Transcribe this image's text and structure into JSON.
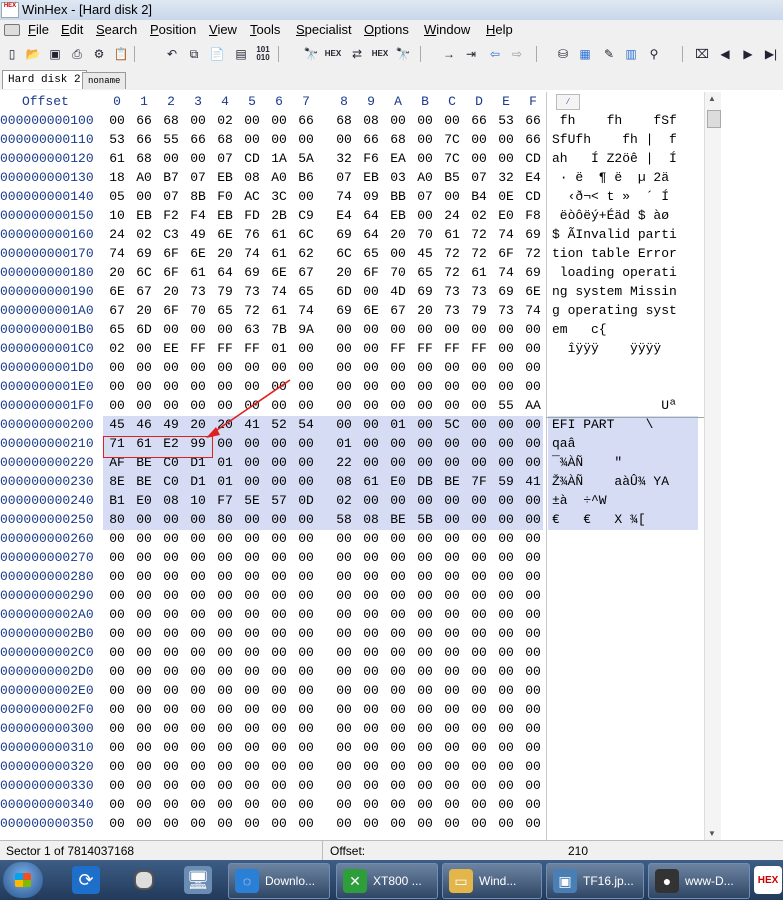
{
  "window": {
    "title": "WinHex - [Hard disk 2]",
    "app_icon_text": "HEX"
  },
  "menu": [
    "File",
    "Edit",
    "Search",
    "Position",
    "View",
    "Tools",
    "Specialist",
    "Options",
    "Window",
    "Help"
  ],
  "toolbar_icons": [
    "new-file-icon",
    "open-folder-icon",
    "save-icon",
    "print-icon",
    "properties-icon",
    "clipboard-icon",
    "undo-icon",
    "copy-icon",
    "paste-icon",
    "paste-special-icon",
    "binary-icon",
    "find-icon",
    "find-hex-icon",
    "replace-icon",
    "replace-hex-icon",
    "find-next-icon",
    "goto-offset-icon",
    "goto-sector-icon",
    "back-icon",
    "forward-icon",
    "disk-editor-icon",
    "ram-editor-icon",
    "tools-icon",
    "calculator-icon",
    "search-magnify-icon",
    "close-icon",
    "prev-icon",
    "next-icon",
    "last-icon"
  ],
  "toolbar_small_labels": {
    "binary": "101\n010",
    "hex": "HEX"
  },
  "tabs": [
    {
      "label": "Hard disk 2",
      "active": true
    },
    {
      "label": "noname",
      "active": false
    }
  ],
  "header": {
    "offset_label": "Offset",
    "columns": [
      "0",
      "1",
      "2",
      "3",
      "4",
      "5",
      "6",
      "7",
      "8",
      "9",
      "A",
      "B",
      "C",
      "D",
      "E",
      "F"
    ]
  },
  "rows": [
    {
      "offset": "000000000100",
      "bytes": [
        "00",
        "66",
        "68",
        "00",
        "02",
        "00",
        "00",
        "66",
        "68",
        "08",
        "00",
        "00",
        "00",
        "66",
        "53",
        "66"
      ],
      "text": " fh    fh    fSf"
    },
    {
      "offset": "000000000110",
      "bytes": [
        "53",
        "66",
        "55",
        "66",
        "68",
        "00",
        "00",
        "00",
        "00",
        "66",
        "68",
        "00",
        "7C",
        "00",
        "00",
        "66"
      ],
      "text": "SfUfh    fh |  f"
    },
    {
      "offset": "000000000120",
      "bytes": [
        "61",
        "68",
        "00",
        "00",
        "07",
        "CD",
        "1A",
        "5A",
        "32",
        "F6",
        "EA",
        "00",
        "7C",
        "00",
        "00",
        "CD"
      ],
      "text": "ah   Í Z2öê |  Í"
    },
    {
      "offset": "000000000130",
      "bytes": [
        "18",
        "A0",
        "B7",
        "07",
        "EB",
        "08",
        "A0",
        "B6",
        "07",
        "EB",
        "03",
        "A0",
        "B5",
        "07",
        "32",
        "E4"
      ],
      "text": " · ë  ¶ ë  µ 2ä"
    },
    {
      "offset": "000000000140",
      "bytes": [
        "05",
        "00",
        "07",
        "8B",
        "F0",
        "AC",
        "3C",
        "00",
        "74",
        "09",
        "BB",
        "07",
        "00",
        "B4",
        "0E",
        "CD"
      ],
      "text": "  ‹ð¬< t »  ´ Í"
    },
    {
      "offset": "000000000150",
      "bytes": [
        "10",
        "EB",
        "F2",
        "F4",
        "EB",
        "FD",
        "2B",
        "C9",
        "E4",
        "64",
        "EB",
        "00",
        "24",
        "02",
        "E0",
        "F8"
      ],
      "text": " ëòôëý+Éäd $ àø"
    },
    {
      "offset": "000000000160",
      "bytes": [
        "24",
        "02",
        "C3",
        "49",
        "6E",
        "76",
        "61",
        "6C",
        "69",
        "64",
        "20",
        "70",
        "61",
        "72",
        "74",
        "69"
      ],
      "text": "$ ÃInvalid parti"
    },
    {
      "offset": "000000000170",
      "bytes": [
        "74",
        "69",
        "6F",
        "6E",
        "20",
        "74",
        "61",
        "62",
        "6C",
        "65",
        "00",
        "45",
        "72",
        "72",
        "6F",
        "72"
      ],
      "text": "tion table Error"
    },
    {
      "offset": "000000000180",
      "bytes": [
        "20",
        "6C",
        "6F",
        "61",
        "64",
        "69",
        "6E",
        "67",
        "20",
        "6F",
        "70",
        "65",
        "72",
        "61",
        "74",
        "69"
      ],
      "text": " loading operati"
    },
    {
      "offset": "000000000190",
      "bytes": [
        "6E",
        "67",
        "20",
        "73",
        "79",
        "73",
        "74",
        "65",
        "6D",
        "00",
        "4D",
        "69",
        "73",
        "73",
        "69",
        "6E"
      ],
      "text": "ng system Missin"
    },
    {
      "offset": "0000000001A0",
      "bytes": [
        "67",
        "20",
        "6F",
        "70",
        "65",
        "72",
        "61",
        "74",
        "69",
        "6E",
        "67",
        "20",
        "73",
        "79",
        "73",
        "74"
      ],
      "text": "g operating syst"
    },
    {
      "offset": "0000000001B0",
      "bytes": [
        "65",
        "6D",
        "00",
        "00",
        "00",
        "63",
        "7B",
        "9A",
        "00",
        "00",
        "00",
        "00",
        "00",
        "00",
        "00",
        "00"
      ],
      "text": "em   c{"
    },
    {
      "offset": "0000000001C0",
      "bytes": [
        "02",
        "00",
        "EE",
        "FF",
        "FF",
        "FF",
        "01",
        "00",
        "00",
        "00",
        "FF",
        "FF",
        "FF",
        "FF",
        "00",
        "00"
      ],
      "text": "  îÿÿÿ    ÿÿÿÿ"
    },
    {
      "offset": "0000000001D0",
      "bytes": [
        "00",
        "00",
        "00",
        "00",
        "00",
        "00",
        "00",
        "00",
        "00",
        "00",
        "00",
        "00",
        "00",
        "00",
        "00",
        "00"
      ],
      "text": ""
    },
    {
      "offset": "0000000001E0",
      "bytes": [
        "00",
        "00",
        "00",
        "00",
        "00",
        "00",
        "00",
        "00",
        "00",
        "00",
        "00",
        "00",
        "00",
        "00",
        "00",
        "00"
      ],
      "text": ""
    },
    {
      "offset": "0000000001F0",
      "bytes": [
        "00",
        "00",
        "00",
        "00",
        "00",
        "00",
        "00",
        "00",
        "00",
        "00",
        "00",
        "00",
        "00",
        "00",
        "55",
        "AA"
      ],
      "text": "              Uª"
    },
    {
      "offset": "000000000200",
      "bytes": [
        "45",
        "46",
        "49",
        "20",
        "20",
        "41",
        "52",
        "54",
        "00",
        "00",
        "01",
        "00",
        "5C",
        "00",
        "00",
        "00"
      ],
      "text": "EFI PART    \\"
    },
    {
      "offset": "000000000210",
      "bytes": [
        "71",
        "61",
        "E2",
        "99",
        "00",
        "00",
        "00",
        "00",
        "01",
        "00",
        "00",
        "00",
        "00",
        "00",
        "00",
        "00"
      ],
      "text": "qaâ"
    },
    {
      "offset": "000000000220",
      "bytes": [
        "AF",
        "BE",
        "C0",
        "D1",
        "01",
        "00",
        "00",
        "00",
        "22",
        "00",
        "00",
        "00",
        "00",
        "00",
        "00",
        "00"
      ],
      "text": "¯¾ÀÑ    \""
    },
    {
      "offset": "000000000230",
      "bytes": [
        "8E",
        "BE",
        "C0",
        "D1",
        "01",
        "00",
        "00",
        "00",
        "08",
        "61",
        "E0",
        "DB",
        "BE",
        "7F",
        "59",
        "41"
      ],
      "text": "Ž¾ÀÑ    aàÛ¾ YA"
    },
    {
      "offset": "000000000240",
      "bytes": [
        "B1",
        "E0",
        "08",
        "10",
        "F7",
        "5E",
        "57",
        "0D",
        "02",
        "00",
        "00",
        "00",
        "00",
        "00",
        "00",
        "00"
      ],
      "text": "±à  ÷^W"
    },
    {
      "offset": "000000000250",
      "bytes": [
        "80",
        "00",
        "00",
        "00",
        "80",
        "00",
        "00",
        "00",
        "58",
        "08",
        "BE",
        "5B",
        "00",
        "00",
        "00",
        "00"
      ],
      "text": "€   €   X ¾["
    },
    {
      "offset": "000000000260",
      "bytes": [
        "00",
        "00",
        "00",
        "00",
        "00",
        "00",
        "00",
        "00",
        "00",
        "00",
        "00",
        "00",
        "00",
        "00",
        "00",
        "00"
      ],
      "text": ""
    },
    {
      "offset": "000000000270",
      "bytes": [
        "00",
        "00",
        "00",
        "00",
        "00",
        "00",
        "00",
        "00",
        "00",
        "00",
        "00",
        "00",
        "00",
        "00",
        "00",
        "00"
      ],
      "text": ""
    },
    {
      "offset": "000000000280",
      "bytes": [
        "00",
        "00",
        "00",
        "00",
        "00",
        "00",
        "00",
        "00",
        "00",
        "00",
        "00",
        "00",
        "00",
        "00",
        "00",
        "00"
      ],
      "text": ""
    },
    {
      "offset": "000000000290",
      "bytes": [
        "00",
        "00",
        "00",
        "00",
        "00",
        "00",
        "00",
        "00",
        "00",
        "00",
        "00",
        "00",
        "00",
        "00",
        "00",
        "00"
      ],
      "text": ""
    },
    {
      "offset": "0000000002A0",
      "bytes": [
        "00",
        "00",
        "00",
        "00",
        "00",
        "00",
        "00",
        "00",
        "00",
        "00",
        "00",
        "00",
        "00",
        "00",
        "00",
        "00"
      ],
      "text": ""
    },
    {
      "offset": "0000000002B0",
      "bytes": [
        "00",
        "00",
        "00",
        "00",
        "00",
        "00",
        "00",
        "00",
        "00",
        "00",
        "00",
        "00",
        "00",
        "00",
        "00",
        "00"
      ],
      "text": ""
    },
    {
      "offset": "0000000002C0",
      "bytes": [
        "00",
        "00",
        "00",
        "00",
        "00",
        "00",
        "00",
        "00",
        "00",
        "00",
        "00",
        "00",
        "00",
        "00",
        "00",
        "00"
      ],
      "text": ""
    },
    {
      "offset": "0000000002D0",
      "bytes": [
        "00",
        "00",
        "00",
        "00",
        "00",
        "00",
        "00",
        "00",
        "00",
        "00",
        "00",
        "00",
        "00",
        "00",
        "00",
        "00"
      ],
      "text": ""
    },
    {
      "offset": "0000000002E0",
      "bytes": [
        "00",
        "00",
        "00",
        "00",
        "00",
        "00",
        "00",
        "00",
        "00",
        "00",
        "00",
        "00",
        "00",
        "00",
        "00",
        "00"
      ],
      "text": ""
    },
    {
      "offset": "0000000002F0",
      "bytes": [
        "00",
        "00",
        "00",
        "00",
        "00",
        "00",
        "00",
        "00",
        "00",
        "00",
        "00",
        "00",
        "00",
        "00",
        "00",
        "00"
      ],
      "text": ""
    },
    {
      "offset": "000000000300",
      "bytes": [
        "00",
        "00",
        "00",
        "00",
        "00",
        "00",
        "00",
        "00",
        "00",
        "00",
        "00",
        "00",
        "00",
        "00",
        "00",
        "00"
      ],
      "text": ""
    },
    {
      "offset": "000000000310",
      "bytes": [
        "00",
        "00",
        "00",
        "00",
        "00",
        "00",
        "00",
        "00",
        "00",
        "00",
        "00",
        "00",
        "00",
        "00",
        "00",
        "00"
      ],
      "text": ""
    },
    {
      "offset": "000000000320",
      "bytes": [
        "00",
        "00",
        "00",
        "00",
        "00",
        "00",
        "00",
        "00",
        "00",
        "00",
        "00",
        "00",
        "00",
        "00",
        "00",
        "00"
      ],
      "text": ""
    },
    {
      "offset": "000000000330",
      "bytes": [
        "00",
        "00",
        "00",
        "00",
        "00",
        "00",
        "00",
        "00",
        "00",
        "00",
        "00",
        "00",
        "00",
        "00",
        "00",
        "00"
      ],
      "text": ""
    },
    {
      "offset": "000000000340",
      "bytes": [
        "00",
        "00",
        "00",
        "00",
        "00",
        "00",
        "00",
        "00",
        "00",
        "00",
        "00",
        "00",
        "00",
        "00",
        "00",
        "00"
      ],
      "text": ""
    },
    {
      "offset": "000000000350",
      "bytes": [
        "00",
        "00",
        "00",
        "00",
        "00",
        "00",
        "00",
        "00",
        "00",
        "00",
        "00",
        "00",
        "00",
        "00",
        "00",
        "00"
      ],
      "text": ""
    }
  ],
  "selected_rows": [
    "000000000200",
    "000000000210",
    "000000000220",
    "000000000230",
    "000000000240",
    "000000000250"
  ],
  "status": {
    "sector": "Sector 1 of 7814037168",
    "offset_label": "Offset:",
    "offset_value": "210"
  },
  "taskbar": {
    "tasks": [
      {
        "label": "Downlo...",
        "icon": "browser-icon",
        "color": "#2a7fd6"
      },
      {
        "label": "XT800 ...",
        "icon": "remote-desktop-icon",
        "color": "#2e9e3a"
      },
      {
        "label": "Wind...",
        "icon": "folder-icon",
        "color": "#e2b64a"
      },
      {
        "label": "TF16.jp...",
        "icon": "image-viewer-icon",
        "color": "#4a7fb5"
      },
      {
        "label": "www-D...",
        "icon": "penguin-icon",
        "color": "#333333"
      }
    ],
    "tray_icon_text": "HEX"
  },
  "colors": {
    "offset_text": "#1a3a8a",
    "selection": "#d6dcf3",
    "annotation": "#e02020"
  }
}
